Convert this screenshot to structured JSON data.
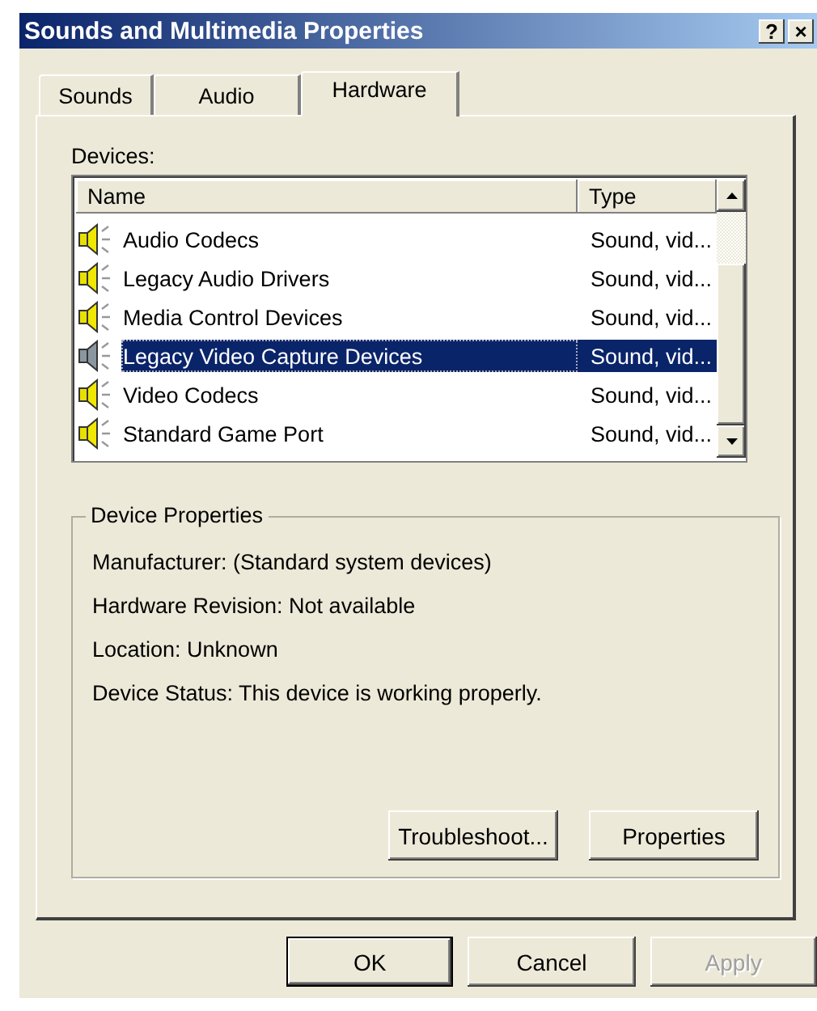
{
  "window": {
    "title": "Sounds and Multimedia Properties",
    "help_glyph": "?",
    "close_glyph": "×"
  },
  "tabs": [
    {
      "label": "Sounds",
      "selected": false
    },
    {
      "label": "Audio",
      "selected": false
    },
    {
      "label": "Hardware",
      "selected": true
    }
  ],
  "devices": {
    "label": "Devices:",
    "columns": [
      "Name",
      "Type"
    ],
    "rows": [
      {
        "name": "Audio Codecs",
        "type": "Sound, vid...",
        "selected": false
      },
      {
        "name": "Legacy Audio Drivers",
        "type": "Sound, vid...",
        "selected": false
      },
      {
        "name": "Media Control Devices",
        "type": "Sound, vid...",
        "selected": false
      },
      {
        "name": "Legacy Video Capture Devices",
        "type": "Sound, vid...",
        "selected": true
      },
      {
        "name": "Video Codecs",
        "type": "Sound, vid...",
        "selected": false
      },
      {
        "name": "Standard Game Port",
        "type": "Sound, vid...",
        "selected": false
      }
    ]
  },
  "device_properties": {
    "title": "Device Properties",
    "lines": [
      "Manufacturer: (Standard system devices)",
      "Hardware Revision: Not available",
      "Location: Unknown",
      "Device Status: This device is working properly."
    ],
    "buttons": [
      {
        "label": "Troubleshoot...",
        "disabled": false
      },
      {
        "label": "Properties",
        "disabled": false
      }
    ]
  },
  "buttons": [
    {
      "label": "OK",
      "default": true,
      "disabled": false
    },
    {
      "label": "Cancel",
      "default": false,
      "disabled": false
    },
    {
      "label": "Apply",
      "default": false,
      "disabled": true
    }
  ]
}
